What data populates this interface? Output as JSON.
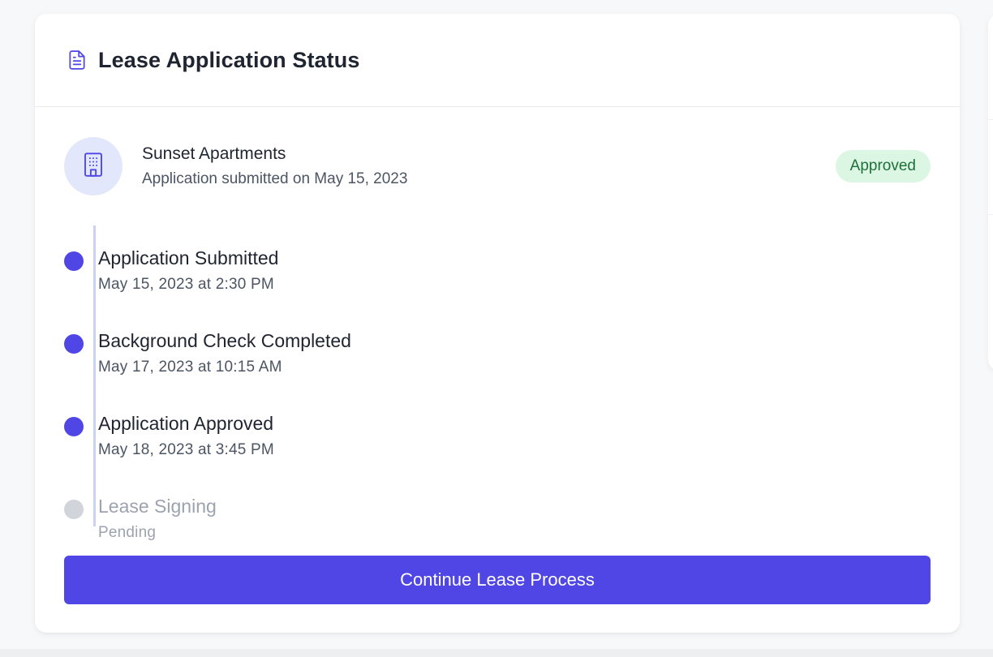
{
  "header": {
    "icon": "document-icon",
    "title": "Lease Application Status"
  },
  "property": {
    "icon": "building-icon",
    "name": "Sunset Apartments",
    "submitted": "Application submitted on May 15, 2023",
    "status": "Approved"
  },
  "timeline": [
    {
      "title": "Application Submitted",
      "date": "May 15, 2023 at 2:30 PM",
      "state": "completed"
    },
    {
      "title": "Background Check Completed",
      "date": "May 17, 2023 at 10:15 AM",
      "state": "completed"
    },
    {
      "title": "Application Approved",
      "date": "May 18, 2023 at 3:45 PM",
      "state": "completed"
    },
    {
      "title": "Lease Signing",
      "date": "Pending",
      "state": "pending"
    }
  ],
  "cta": {
    "label": "Continue Lease Process"
  },
  "colors": {
    "accent": "#4f46e5",
    "badge_bg": "#dcf6e4",
    "badge_text": "#1f6f3b",
    "pending": "#d1d5db"
  }
}
